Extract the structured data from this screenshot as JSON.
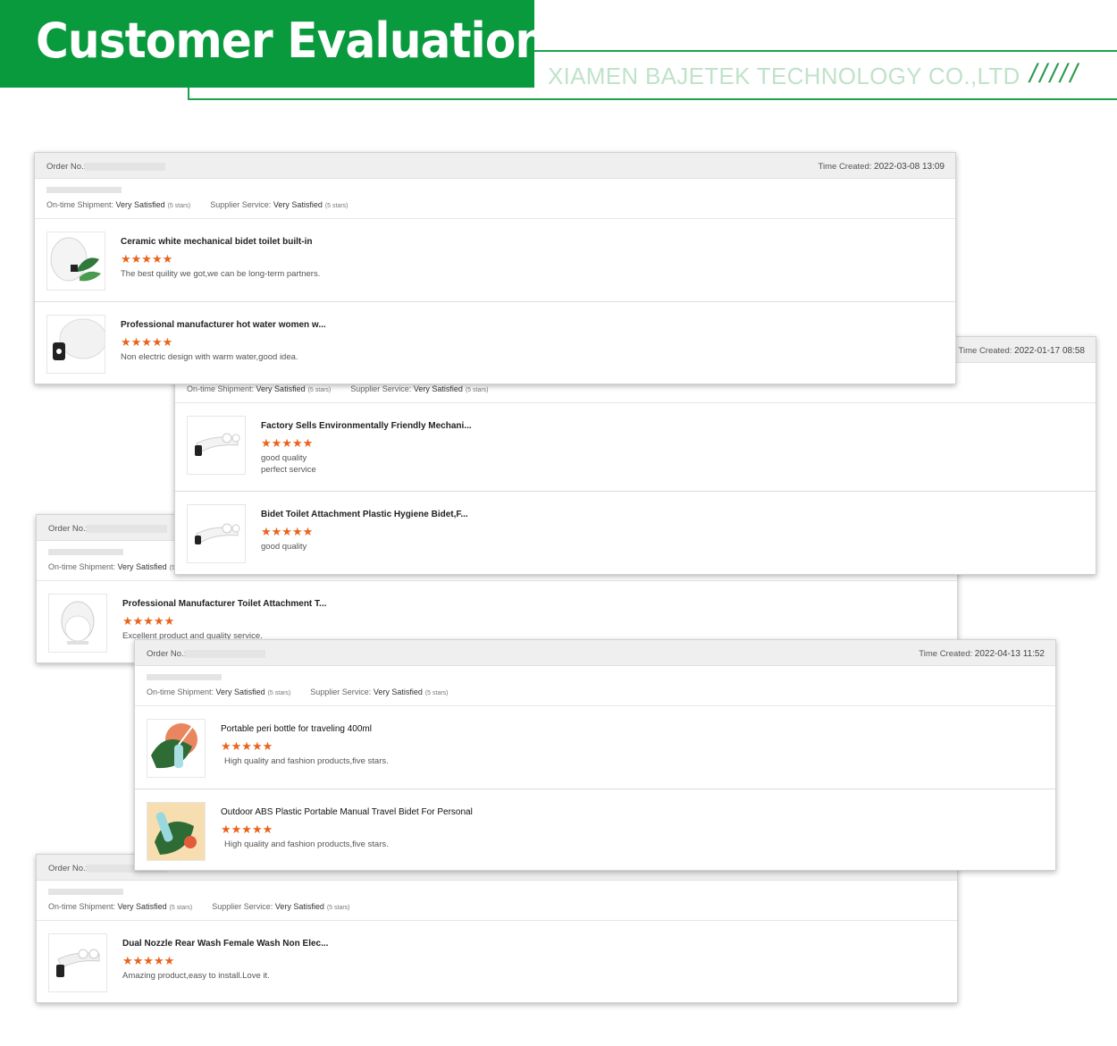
{
  "header": {
    "title": "Customer Evaluation",
    "company": "XIAMEN BAJETEK TECHNOLOGY CO.,LTD",
    "slashes": "/////"
  },
  "labels": {
    "order_no": "Order No.:",
    "time_created": "Time Created:",
    "ontime": "On-time Shipment:",
    "supplier": "Supplier Service:",
    "very_satisfied": "Very Satisfied",
    "five_stars": "(5 stars)",
    "rating_stars": "★★★★★"
  },
  "colors": {
    "banner_green": "#0a9a3e",
    "star_orange": "#e8641c"
  },
  "cards": [
    {
      "time": "2022-03-08 13:09",
      "items": [
        {
          "name": "Ceramic white mechanical bidet toilet built-in",
          "comment": "The best quility we got,we can be long-term partners.",
          "icon": "toilet-seat-plant-thumbnail"
        },
        {
          "name": "Professional manufacturer hot water women w...",
          "comment": "Non electric design with warm water,good idea.",
          "icon": "bidet-attachment-thumbnail"
        }
      ]
    },
    {
      "time": "2022-01-17 08:58",
      "items": [
        {
          "name": "Factory Sells Environmentally Friendly Mechani...",
          "comment": "good quality\nperfect service",
          "icon": "bidet-attachment-thumbnail"
        },
        {
          "name": "Bidet Toilet Attachment Plastic Hygiene Bidet,F...",
          "comment": "good quality",
          "icon": "bidet-attachment-thumbnail"
        }
      ]
    },
    {
      "time": "",
      "items": [
        {
          "name": "Professional Manufacturer Toilet Attachment T...",
          "comment": "Excellent product and quality service.",
          "icon": "toilet-seat-thumbnail"
        }
      ]
    },
    {
      "time": "2022-04-13 11:52",
      "items": [
        {
          "name": "Portable peri bottle for traveling 400ml",
          "comment": "High quality and fashion products,five stars.",
          "icon": "peri-bottle-thumbnail"
        },
        {
          "name": "Outdoor ABS Plastic Portable Manual Travel Bidet For Personal",
          "comment": "High quality and fashion products,five stars.",
          "icon": "travel-bidet-thumbnail"
        }
      ]
    },
    {
      "time": "",
      "items": [
        {
          "name": "Dual Nozzle Rear Wash Female Wash Non Elec...",
          "comment": "Amazing product,easy to install.Love it.",
          "icon": "dual-nozzle-bidet-thumbnail"
        }
      ]
    }
  ]
}
